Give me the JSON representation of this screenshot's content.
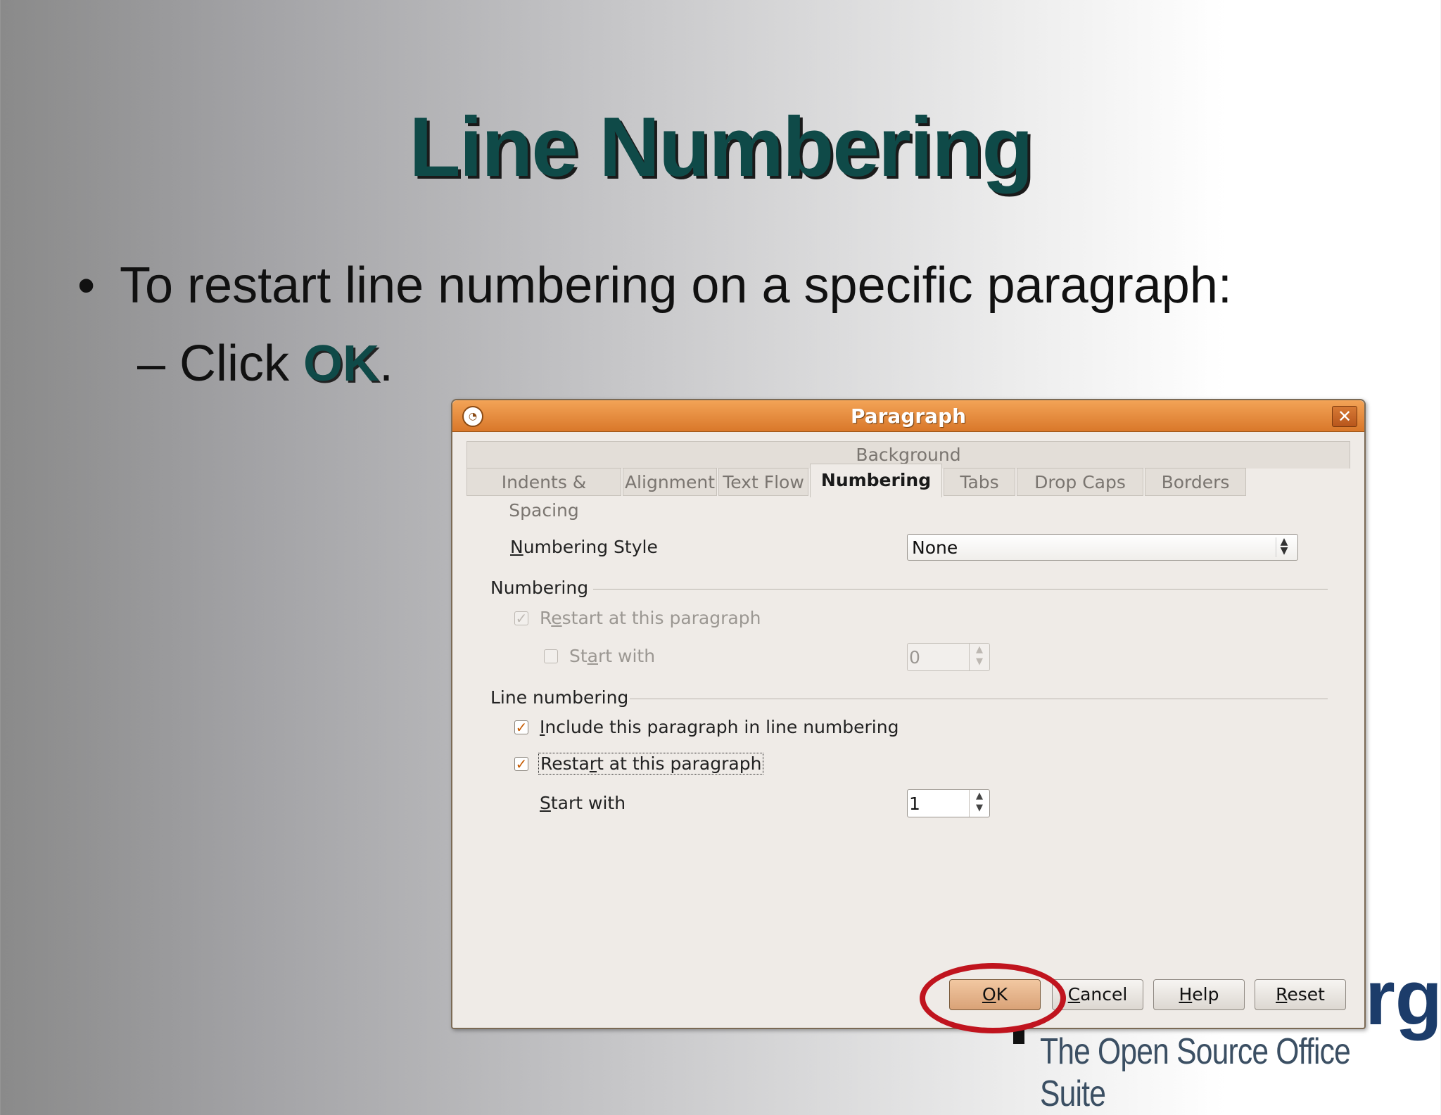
{
  "slide": {
    "title": "Line Numbering",
    "bullet_marker": "•",
    "bullet_text": "To restart line numbering on a specific paragraph:",
    "sub_prefix": "– Click ",
    "sub_highlight": "OK",
    "sub_suffix": "."
  },
  "logo": {
    "fragment": "rg",
    "tagline": "The Open Source Office Suite"
  },
  "dialog": {
    "title": "Paragraph",
    "close_glyph": "✕",
    "tabs_row1": [
      "Background"
    ],
    "tabs_row2": [
      "Indents & Spacing",
      "Alignment",
      "Text Flow",
      "Numbering",
      "Tabs",
      "Drop Caps",
      "Borders"
    ],
    "active_tab": "Numbering",
    "numbering_style": {
      "label_first": "N",
      "label_rest": "umbering Style",
      "value": "None"
    },
    "numbering_group": {
      "heading": "Numbering",
      "restart_label_first": "R",
      "restart_label_mid": "e",
      "restart_label_rest": "start at this paragraph",
      "start_with_label_a": "St",
      "start_with_label_b": "a",
      "start_with_label_c": "rt with",
      "start_with_value": "0"
    },
    "line_numbering_group": {
      "heading": "Line numbering",
      "include_label_first": "I",
      "include_label_rest": "nclude this paragraph in line numbering",
      "restart_label_a": "Resta",
      "restart_label_b": "r",
      "restart_label_c": "t at this paragraph",
      "start_with_label_first": "S",
      "start_with_label_rest": "tart with",
      "start_with_value": "1"
    },
    "buttons": {
      "ok_first": "O",
      "ok_rest": "K",
      "cancel_first": "C",
      "cancel_rest": "ancel",
      "help_first": "H",
      "help_rest": "elp",
      "reset_first": "R",
      "reset_rest": "eset"
    }
  }
}
